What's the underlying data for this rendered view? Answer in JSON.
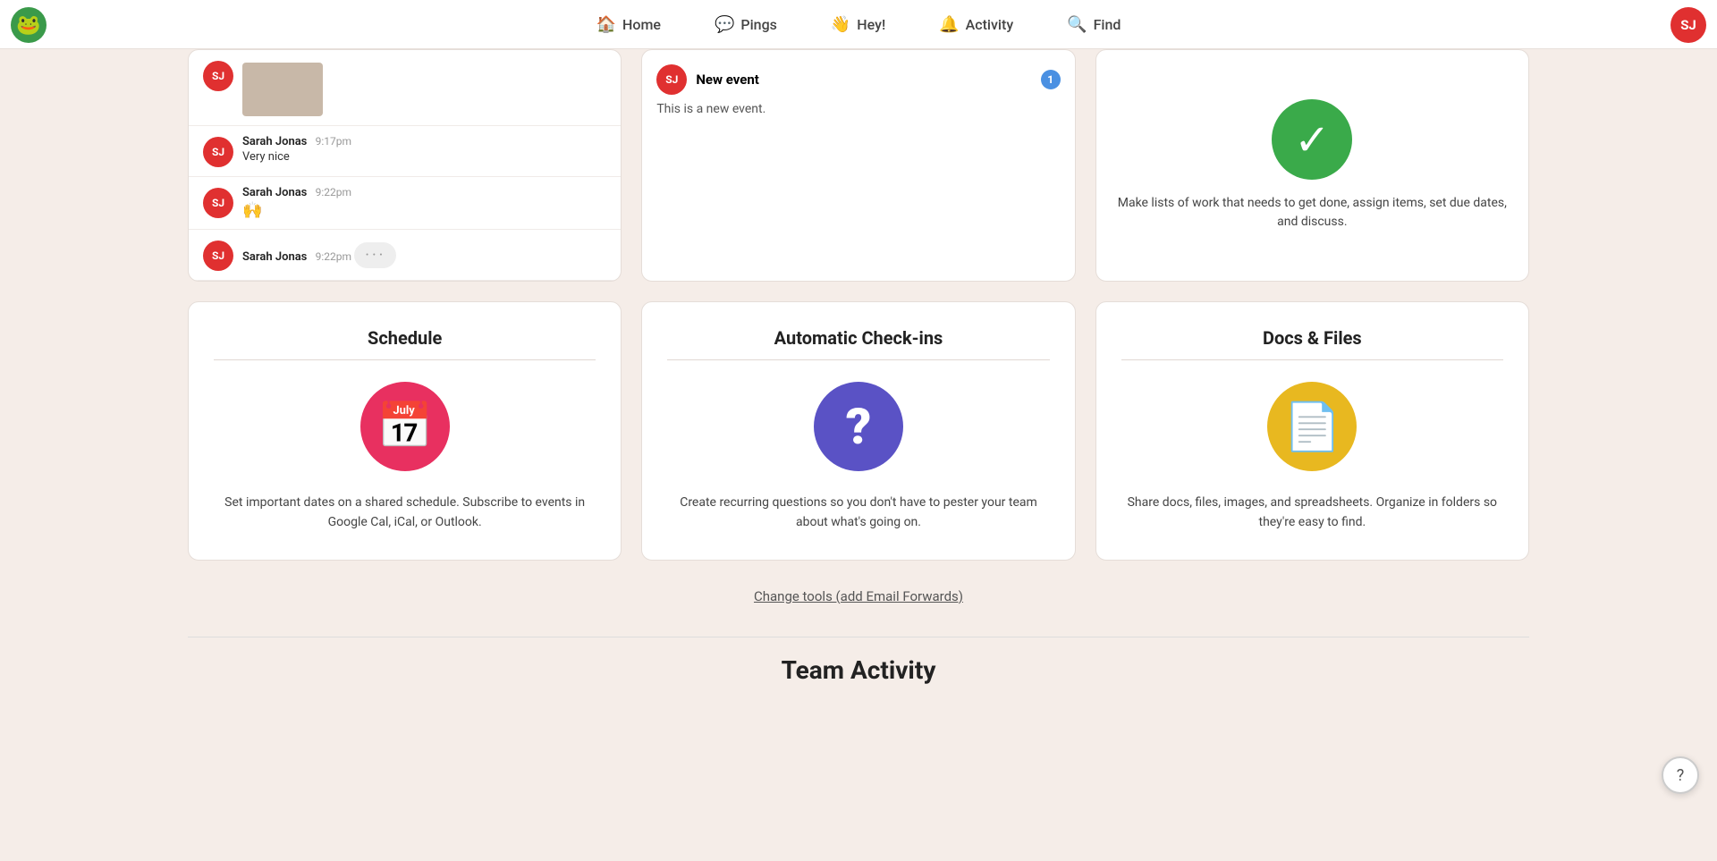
{
  "app": {
    "logo": "🐸",
    "user_initials": "SJ"
  },
  "nav": {
    "home_label": "Home",
    "pings_label": "Pings",
    "hey_label": "Hey!",
    "activity_label": "Activity",
    "find_label": "Find"
  },
  "chat_card": {
    "messages": [
      {
        "initials": "SJ",
        "name": "Sarah Jonas",
        "time": "9:17pm",
        "text": "Very nice",
        "has_image": false
      },
      {
        "initials": "SJ",
        "name": "Sarah Jonas",
        "time": "9:22pm",
        "text": "🙌",
        "has_image": false,
        "emoji": true
      },
      {
        "initials": "SJ",
        "name": "Sarah Jonas",
        "time": "9:22pm",
        "text": "···",
        "has_image": false,
        "typing": true
      }
    ]
  },
  "event_card": {
    "initials": "SJ",
    "title": "New event",
    "subtitle": "This is a new event.",
    "badge": "1"
  },
  "todo_card": {
    "description": "Make lists of work that needs to get done, assign items, set due dates, and discuss."
  },
  "features": [
    {
      "id": "schedule",
      "title": "Schedule",
      "icon": "📅",
      "icon_class": "icon-red",
      "description": "Set important dates on a shared schedule. Subscribe to events in Google Cal, iCal, or Outlook."
    },
    {
      "id": "checkins",
      "title": "Automatic Check-ins",
      "icon": "?",
      "icon_class": "icon-purple",
      "description": "Create recurring questions so you don't have to pester your team about what's going on."
    },
    {
      "id": "docs",
      "title": "Docs & Files",
      "icon": "📄",
      "icon_class": "icon-yellow",
      "description": "Share docs, files, images, and spreadsheets. Organize in folders so they're easy to find."
    }
  ],
  "change_tools": {
    "label": "Change tools (add Email Forwards)"
  },
  "team_activity": {
    "title": "Team Activity"
  },
  "help": {
    "icon": "?"
  }
}
